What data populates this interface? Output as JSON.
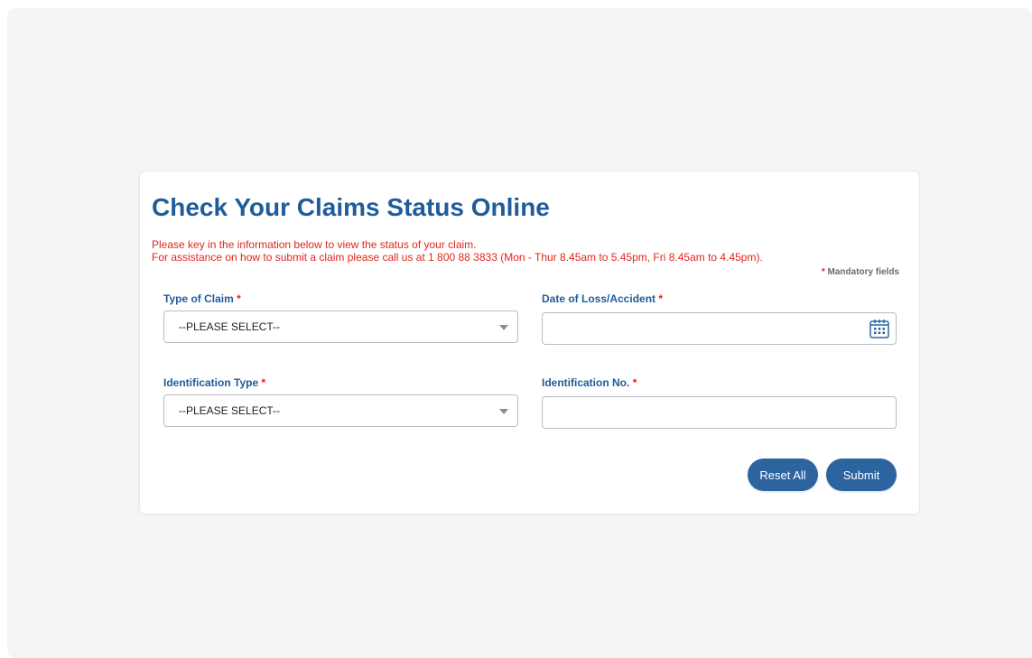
{
  "page": {
    "title": "Check Your Claims Status Online",
    "intro_line1": "Please key in the information below to view the status of your claim.",
    "intro_line2": "For assistance on how to submit a claim please call us at 1 800 88 3833 (Mon - Thur 8.45am to 5.45pm, Fri 8.45am to 4.45pm).",
    "mandatory_star": "*",
    "mandatory_note": "Mandatory fields"
  },
  "form": {
    "required_mark": "*",
    "type_of_claim": {
      "label": "Type of Claim",
      "selected": "--PLEASE SELECT--"
    },
    "date_of_loss": {
      "label": "Date of Loss/Accident",
      "value": "",
      "icon": "calendar-icon"
    },
    "identification_type": {
      "label": "Identification Type",
      "selected": "--PLEASE SELECT--"
    },
    "identification_no": {
      "label": "Identification No.",
      "value": ""
    }
  },
  "actions": {
    "reset_label": "Reset All",
    "submit_label": "Submit"
  },
  "colors": {
    "title": "#1f5c99",
    "notice": "#e1261c",
    "button": "#2c64a0",
    "background": "#f4f5f7"
  }
}
